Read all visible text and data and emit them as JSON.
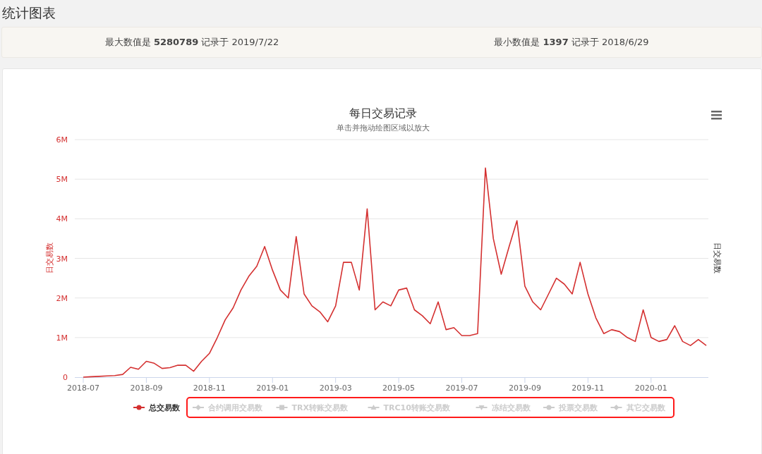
{
  "page_title": "统计图表",
  "stats": [
    "最大数值是 **5280789** 记录于 2019/7/22",
    "最小数值是 **1397** 记录于 2018/6/29"
  ],
  "chart": {
    "menu": true,
    "right_axis_title": "日交易数",
    "hidden_series": [
      {
        "label": "合约调用交易数",
        "kind": "diamond",
        "visible": false
      },
      {
        "label": "TRX转账交易数",
        "kind": "square",
        "visible": false
      },
      {
        "label": "TRC10转账交易数",
        "kind": "triangle",
        "visible": false
      },
      {
        "label": "冻结交易数",
        "kind": "triangle-down",
        "visible": false
      },
      {
        "label": "投票交易数",
        "kind": "circle",
        "visible": false
      },
      {
        "label": "其它交易数",
        "kind": "diamond",
        "visible": false
      }
    ],
    "chart_data": {
      "type": "line",
      "title": "每日交易记录",
      "subtitle": "单击并拖动绘图区域以放大",
      "ylabel": "日交易数",
      "grid": true,
      "ylim": [
        0,
        6
      ],
      "yticks": [
        {
          "value": 0,
          "label": "0"
        },
        {
          "value": 1,
          "label": "1M"
        },
        {
          "value": 2,
          "label": "2M"
        },
        {
          "value": 3,
          "label": "3M"
        },
        {
          "value": 4,
          "label": "4M"
        },
        {
          "value": 5,
          "label": "5M"
        },
        {
          "value": 6,
          "label": "6M"
        }
      ],
      "categories": [
        "2018-07",
        null,
        null,
        null,
        null,
        null,
        null,
        null,
        "2018-09",
        null,
        null,
        null,
        null,
        null,
        null,
        null,
        "2018-11",
        null,
        null,
        null,
        null,
        null,
        null,
        null,
        "2019-01",
        null,
        null,
        null,
        null,
        null,
        null,
        null,
        "2019-03",
        null,
        null,
        null,
        null,
        null,
        null,
        null,
        "2019-05",
        null,
        null,
        null,
        null,
        null,
        null,
        null,
        "2019-07",
        null,
        null,
        null,
        null,
        null,
        null,
        null,
        "2019-09",
        null,
        null,
        null,
        null,
        null,
        null,
        null,
        "2019-11",
        null,
        null,
        null,
        null,
        null,
        null,
        null,
        "2020-01",
        null,
        null,
        null,
        null,
        null,
        null,
        null
      ],
      "series": [
        {
          "name": "总交易数",
          "color": "#d43030",
          "values": [
            0,
            0.01,
            0.02,
            0.03,
            0.04,
            0.07,
            0.25,
            0.2,
            0.4,
            0.35,
            0.22,
            0.24,
            0.3,
            0.3,
            0.15,
            0.4,
            0.6,
            1.0,
            1.45,
            1.75,
            2.2,
            2.55,
            2.8,
            3.3,
            2.7,
            2.2,
            2.0,
            3.55,
            2.1,
            1.8,
            1.65,
            1.4,
            1.8,
            2.9,
            2.9,
            2.2,
            4.25,
            1.7,
            1.9,
            1.8,
            2.2,
            2.25,
            1.7,
            1.55,
            1.35,
            1.9,
            1.2,
            1.25,
            1.05,
            1.05,
            1.1,
            5.28,
            3.5,
            2.6,
            3.3,
            3.95,
            2.3,
            1.9,
            1.7,
            2.1,
            2.5,
            2.35,
            2.1,
            2.9,
            2.1,
            1.5,
            1.1,
            1.2,
            1.15,
            1.0,
            0.9,
            1.7,
            1.0,
            0.9,
            0.95,
            1.3,
            0.9,
            0.8,
            0.95,
            0.8
          ]
        }
      ]
    }
  }
}
